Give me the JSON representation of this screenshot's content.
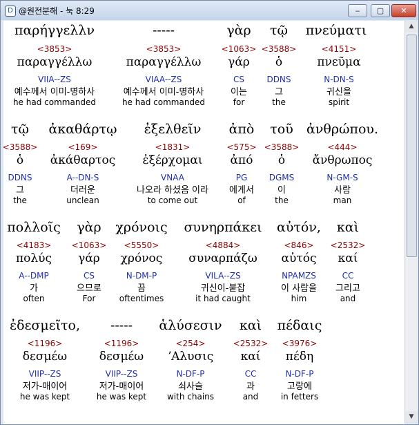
{
  "window": {
    "title": "@원전분해 - 눅 8:29"
  },
  "icons": {
    "app": "app-icon",
    "minimize": "minimize-icon",
    "maximize": "maximize-icon",
    "close": "close-icon"
  },
  "controls": {
    "minimize": "‒",
    "maximize": "▢",
    "close": "✕",
    "app": "D"
  },
  "rows": [
    {
      "greek": [
        "παρήγγελλν",
        "-----",
        "γὰρ",
        "τῷ",
        "πνεύματι"
      ],
      "words": [
        {
          "strong": "<3853>",
          "lemma": "παραγγέλλω",
          "parse": "VIIA--ZS",
          "korean": "예수께서 이미-명하사",
          "english": "he had commanded"
        },
        {
          "strong": "<3853>",
          "lemma": "παραγγέλλω",
          "parse": "VIAA--ZS",
          "korean": "예수께서 이미-명하사",
          "english": "he had commanded"
        },
        {
          "strong": "<1063>",
          "lemma": "γάρ",
          "parse": "CS",
          "korean": "이는",
          "english": "for"
        },
        {
          "strong": "<3588>",
          "lemma": "ὁ",
          "parse": "DDNS",
          "korean": "그",
          "english": "the"
        },
        {
          "strong": "<4151>",
          "lemma": "πνεῦμα",
          "parse": "N-DN-S",
          "korean": "귀신을",
          "english": "spirit"
        }
      ]
    },
    {
      "greek": [
        "τῷ",
        "ἀκαθάρτῳ",
        "ἐξελθεῖν",
        "ἀπὸ",
        "τοῦ",
        "ἀνθρώπου."
      ],
      "words": [
        {
          "strong": "<3588>",
          "lemma": "ὁ",
          "parse": "DDNS",
          "korean": "그",
          "english": "the"
        },
        {
          "strong": "<169>",
          "lemma": "ἀκάθαρτος",
          "parse": "A--DN-S",
          "korean": "더러운",
          "english": "unclean"
        },
        {
          "strong": "<1831>",
          "lemma": "ἐξέρχομαι",
          "parse": "VNAA",
          "korean": "나오라 하셨음 이라",
          "english": "to come out"
        },
        {
          "strong": "<575>",
          "lemma": "ἀπό",
          "parse": "PG",
          "korean": "에게서",
          "english": "of"
        },
        {
          "strong": "<3588>",
          "lemma": "ὁ",
          "parse": "DGMS",
          "korean": "이",
          "english": "the"
        },
        {
          "strong": "<444>",
          "lemma": "ἄνθρωπος",
          "parse": "N-GM-S",
          "korean": "사람",
          "english": "man"
        }
      ]
    },
    {
      "greek": [
        "πολλοῖς",
        "γὰρ",
        "χρόνοις",
        "συνηρπάκει",
        "αὐτόν,",
        "καὶ"
      ],
      "words": [
        {
          "strong": "<4183>",
          "lemma": "πολύς",
          "parse": "A--DMP",
          "korean": "가",
          "english": "often"
        },
        {
          "strong": "<1063>",
          "lemma": "γάρ",
          "parse": "CS",
          "korean": "으므로",
          "english": "For"
        },
        {
          "strong": "<5550>",
          "lemma": "χρόνος",
          "parse": "N-DM-P",
          "korean": "끔",
          "english": "oftentimes"
        },
        {
          "strong": "<4884>",
          "lemma": "συναρπάζω",
          "parse": "VILA--ZS",
          "korean": "귀신이-붙잡",
          "english": "it had caught"
        },
        {
          "strong": "<846>",
          "lemma": "αὐτός",
          "parse": "NPAMZS",
          "korean": "이 사람을",
          "english": "him"
        },
        {
          "strong": "<2532>",
          "lemma": "καί",
          "parse": "CC",
          "korean": "그리고",
          "english": "and"
        }
      ]
    },
    {
      "greek": [
        "ἐδεσμεῖτο,",
        "-----",
        "ἁλύσεσιν",
        "καὶ",
        "πέδαις"
      ],
      "words": [
        {
          "strong": "<1196>",
          "lemma": "δεσμέω",
          "parse": "VIIP--ZS",
          "korean": "저가-매이어",
          "english": "he was kept"
        },
        {
          "strong": "<1196>",
          "lemma": "δεσμέω",
          "parse": "VIIP--ZS",
          "korean": "저가-매이어",
          "english": "he was kept"
        },
        {
          "strong": "<254>",
          "lemma": "ʼΑλυσις",
          "parse": "N-DF-P",
          "korean": "쇠사슬",
          "english": "with chains"
        },
        {
          "strong": "<2532>",
          "lemma": "καί",
          "parse": "CC",
          "korean": "과",
          "english": "and"
        },
        {
          "strong": "<3976>",
          "lemma": "πέδη",
          "parse": "N-DF-P",
          "korean": "고랑에",
          "english": "in fetters"
        }
      ]
    }
  ],
  "colors": {
    "strong": "#8b0000",
    "parse": "#1f2fb0",
    "text": "#000000"
  }
}
